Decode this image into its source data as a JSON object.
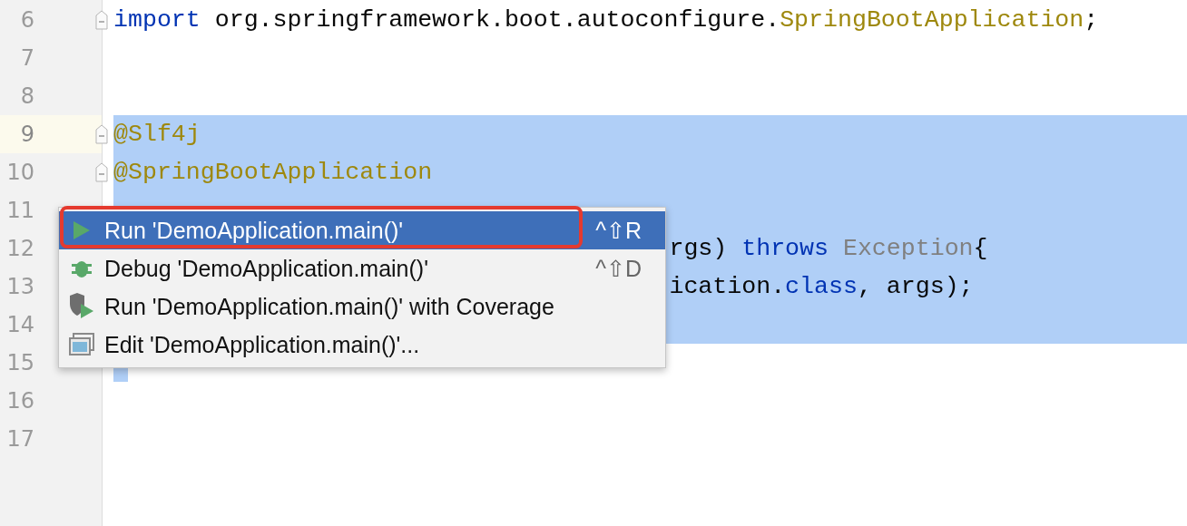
{
  "editor": {
    "lines": [
      {
        "number": "6",
        "fold": true,
        "current": false,
        "selected": false,
        "kind": "normal",
        "tokens": [
          {
            "kind": "keyword",
            "text": "import"
          },
          {
            "kind": "plain",
            "text": " org.springframework.boot.autoconfigure."
          },
          {
            "kind": "annotation",
            "text": "SpringBootApplication"
          },
          {
            "kind": "plain",
            "text": ";"
          }
        ]
      },
      {
        "number": "7",
        "fold": false,
        "current": false,
        "selected": false
      },
      {
        "number": "8",
        "fold": false,
        "current": false,
        "selected": false
      },
      {
        "number": "9",
        "fold": true,
        "current": true,
        "selected": true,
        "kind": "normal",
        "tokens": [
          {
            "kind": "annotation",
            "text": "@Slf4j"
          }
        ]
      },
      {
        "number": "10",
        "fold": true,
        "current": false,
        "selected": true,
        "kind": "normal",
        "tokens": [
          {
            "kind": "annotation",
            "text": "@SpringBootApplication"
          }
        ]
      },
      {
        "number": "11",
        "fold": false,
        "current": false,
        "selected": true
      },
      {
        "number": "12",
        "fold": false,
        "current": false,
        "selected": true,
        "kind": "covered",
        "tokens": [
          {
            "kind": "plain",
            "text": "rgs) "
          },
          {
            "kind": "keyword",
            "text": "throws "
          },
          {
            "kind": "type",
            "text": "Exception"
          },
          {
            "kind": "plain",
            "text": "{"
          }
        ]
      },
      {
        "number": "13",
        "fold": false,
        "current": false,
        "selected": true,
        "kind": "covered",
        "tokens": [
          {
            "kind": "plain",
            "text": "ication."
          },
          {
            "kind": "keyword",
            "text": "class"
          },
          {
            "kind": "plain",
            "text": ", args);"
          }
        ]
      },
      {
        "number": "14",
        "fold": false,
        "current": false,
        "selected": true
      },
      {
        "number": "15",
        "fold": false,
        "current": false,
        "selected": true
      },
      {
        "number": "16",
        "fold": false,
        "current": false,
        "selected": false
      },
      {
        "number": "17",
        "fold": false,
        "current": false,
        "selected": false
      }
    ]
  },
  "popup_menu": {
    "items": [
      {
        "kind": "run",
        "label": "Run 'DemoApplication.main()'",
        "shortcut": "^⇧R",
        "selected": true,
        "outlined": true
      },
      {
        "kind": "debug",
        "label": "Debug 'DemoApplication.main()'",
        "shortcut": "^⇧D",
        "selected": false,
        "outlined": false
      },
      {
        "kind": "coverage",
        "label": "Run 'DemoApplication.main()' with Coverage",
        "selected": false,
        "outlined": false
      },
      {
        "kind": "edit",
        "label": "Edit 'DemoApplication.main()'...",
        "selected": false,
        "outlined": false
      }
    ]
  }
}
